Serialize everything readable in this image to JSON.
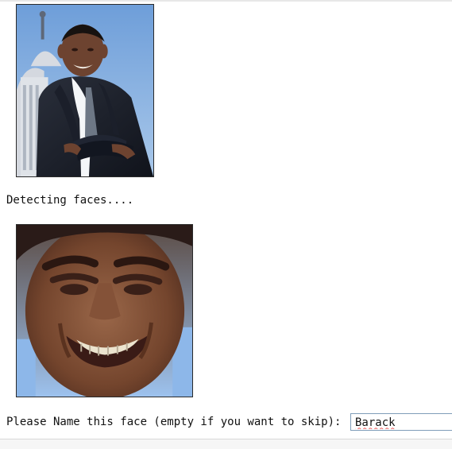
{
  "images": {
    "source_photo": {
      "icon": "person-photo",
      "description_colors": {
        "sky": "#8fb7e6",
        "suit": "#1b1f2a",
        "skin": "#6d4330",
        "building": "#d8dde4"
      }
    },
    "detected_face": {
      "icon": "face-crop",
      "description_colors": {
        "background": "#8fb7e6",
        "skin": "#7b4d32",
        "shadow": "#49291d",
        "teeth": "#e8e1cf"
      }
    }
  },
  "status": {
    "detecting_text": "Detecting faces...."
  },
  "prompt": {
    "label": "Please Name this face (empty if you want to skip): "
  },
  "input": {
    "value": "Barack"
  },
  "theme": {
    "input_border": "#7f9db9",
    "spellcheck_underline": "#ef5b5b"
  }
}
